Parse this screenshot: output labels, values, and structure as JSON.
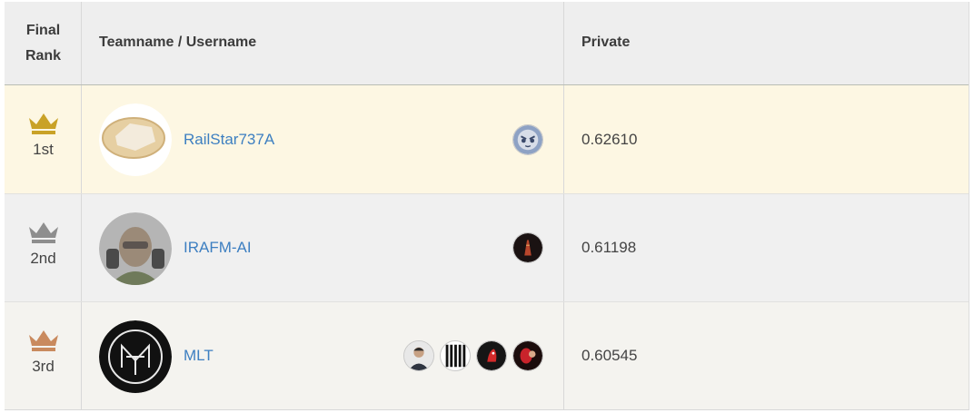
{
  "header": {
    "rank_label": "Final\nRank",
    "team_label": "Teamname / Username",
    "score_label": "Private"
  },
  "rows": [
    {
      "place": "1st",
      "crown_color": "#c9a227",
      "team": "RailStar737A",
      "members": [
        "owl-avatar-icon"
      ],
      "score": "0.62610"
    },
    {
      "place": "2nd",
      "crown_color": "#8e8e8e",
      "team": "IRAFM-AI",
      "members": [
        "dark-tower-avatar-icon"
      ],
      "score": "0.61198"
    },
    {
      "place": "3rd",
      "crown_color": "#c98a5e",
      "team": "MLT",
      "members": [
        "person-avatar-icon",
        "stripes-avatar-icon",
        "red-bird-avatar-icon",
        "red-face-avatar-icon"
      ],
      "score": "0.60545"
    }
  ],
  "colors": {
    "link": "#3d7fc1",
    "gold_row": "#fdf7e3",
    "header_bg": "#eeeeee"
  }
}
